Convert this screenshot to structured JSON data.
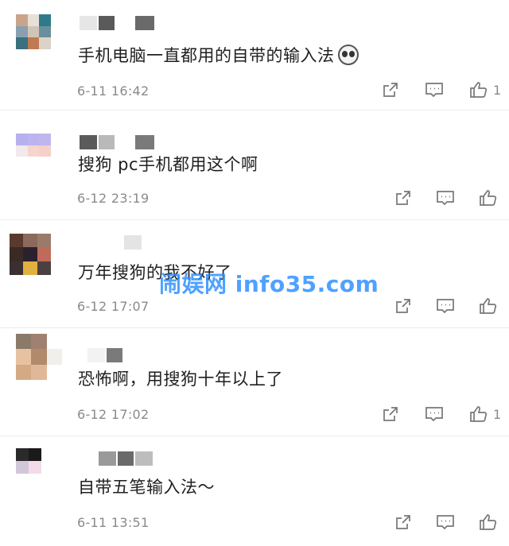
{
  "comments": [
    {
      "text": "手机电脑一直都用的自带的输入法",
      "has_emoji": true,
      "emoji_icon": "panda-face-emoji",
      "time": "6-11 16:42",
      "like_count": "1",
      "avatar_colors": [
        "#c9a48a",
        "#e8e0d8",
        "#2f7a8a",
        "#8aa0b0",
        "#d0c4b6",
        "#6a8f9c",
        "#3b7080",
        "#c07a52",
        "#dcd3c8"
      ],
      "name_colors": [
        "#e6e6e6",
        "#5a5a5a",
        "#ffffff",
        "#6a6a6a"
      ]
    },
    {
      "text": "搜狗 pc手机都用这个啊",
      "has_emoji": false,
      "time": "6-12 23:19",
      "like_count": "",
      "avatar_colors": [
        "#b7b0ef",
        "#bdb3f0",
        "#c0b6ee",
        "#f1e9ea",
        "#f6d5cf",
        "#f7cfc9",
        "#ffffff",
        "#ffffff",
        "#ffffff"
      ],
      "name_colors": [
        "#5b5b5b",
        "#b9b9b9",
        "#ffffff",
        "#7a7a7a"
      ]
    },
    {
      "text": "万年搜狗的我不好了",
      "has_emoji": false,
      "time": "6-12 17:07",
      "like_count": "",
      "avatar_colors": [
        "#5a3a2e",
        "#8a6a5a",
        "#9a7a6a",
        "#3a2a24",
        "#2a2030",
        "#c06a5a",
        "#3a3030",
        "#e0b040",
        "#4a4040"
      ],
      "name_colors": [
        "#ffffff",
        "#ffffff",
        "#e4e4e4"
      ]
    },
    {
      "text": "恐怖啊，用搜狗十年以上了",
      "has_emoji": false,
      "time": "6-12 17:02",
      "like_count": "1",
      "avatar_colors": [
        "#8a7a6a",
        "#a08070",
        "#ffffff",
        "#e6c2a0",
        "#b08a6a",
        "#f2efea",
        "#d4aa84",
        "#e0b898",
        "#ffffff"
      ],
      "name_colors": [
        "#f2f2f2",
        "#7a7a7a",
        "#ffffff"
      ]
    },
    {
      "text": "自带五笔输入法～",
      "has_emoji": false,
      "time": "6-11 13:51",
      "like_count": "",
      "avatar_colors": [
        "#2a2a2a",
        "#1a1a1a",
        "#ffffff",
        "#d0c8d8",
        "#f3dbe8",
        "#ffffff",
        "#ffffff",
        "#ffffff",
        "#ffffff"
      ],
      "name_colors": [
        "#9a9a9a",
        "#6a6a6a",
        "#bdbdbd"
      ]
    }
  ],
  "watermark": "闹娱网 info35.com",
  "icons": {
    "share": "share-icon",
    "reply": "comment-icon",
    "like": "thumbs-up-icon"
  },
  "colors": {
    "text": "#1f1f1f",
    "meta": "#8a8a8a",
    "divider": "#ececec",
    "watermark": "#288cff"
  }
}
